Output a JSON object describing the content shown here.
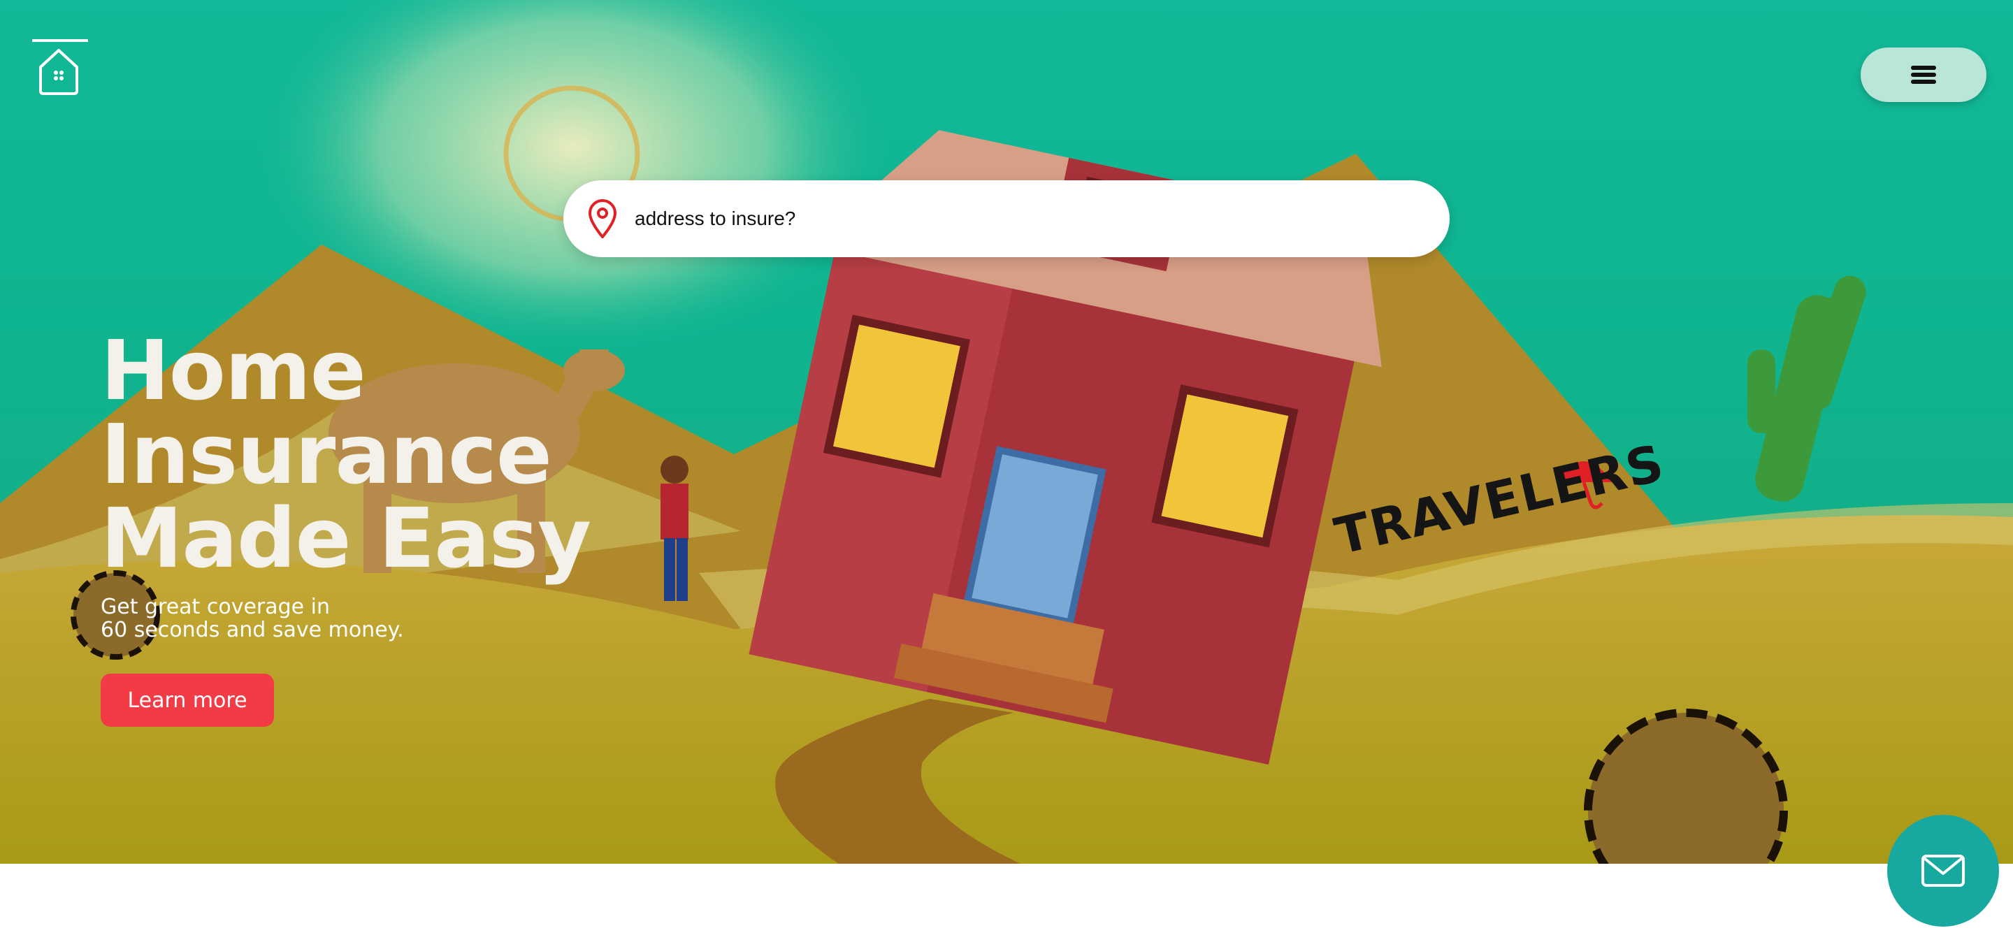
{
  "header": {
    "logo_icon": "home-icon",
    "menu_icon": "hamburger-menu-icon"
  },
  "search": {
    "placeholder": "address to insure?",
    "icon": "location-pin-icon"
  },
  "hero": {
    "headline": [
      "Home",
      "Insurance",
      "Made Easy"
    ],
    "subtext": [
      "Get great coverage in",
      "60 seconds and save money."
    ],
    "cta_label": "Learn more",
    "brand_sign": "TRAVELERS"
  },
  "contact": {
    "icon": "envelope-icon"
  },
  "colors": {
    "sky": "#12b897",
    "cta": "#f23b45",
    "mail_button": "#17a9a0",
    "menu_button": "#b9e6d7"
  }
}
